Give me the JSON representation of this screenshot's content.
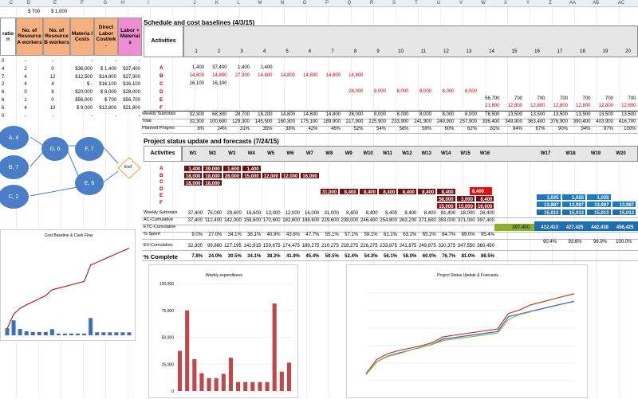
{
  "column_headers": [
    "C",
    "D",
    "E",
    "F",
    "G",
    "H",
    "I",
    "J",
    "K",
    "L",
    "M",
    "N",
    "O",
    "P",
    "Q",
    "R",
    "S",
    "T",
    "U",
    "V",
    "W",
    "X",
    "Y",
    "Z",
    "AA",
    "AB",
    "AC"
  ],
  "top_row": {
    "d": "$ 700",
    "e": "$ 1,000"
  },
  "left_table": {
    "headers": [
      "ratio n",
      "No. of Resource A workers",
      "No. of Resource B workers",
      "Materia l Costs",
      "Direct Labor Cost/wk .",
      "Labor + Material s"
    ],
    "rows": [
      [
        "0",
        "-",
        "-",
        "-",
        "-",
        "-"
      ],
      [
        "4",
        "2",
        "0",
        "$36,000",
        "$ 1,400",
        "$37,400"
      ],
      [
        "7",
        "4",
        "12",
        "$12,500",
        "$14,800",
        "$27,300"
      ],
      [
        "2",
        "4",
        "4",
        "$ -",
        "$16,100",
        "$16,100"
      ],
      [
        "6",
        "0",
        "8",
        "$20,000",
        "$ 8,000",
        "$28,000"
      ],
      [
        "6",
        "1",
        "0",
        "$56,000",
        "$ 700",
        "$56,700"
      ],
      [
        "6",
        "4",
        "10",
        "$ 9,000",
        "$12,800",
        "$21,800"
      ],
      [
        "0",
        "-",
        "-",
        "-",
        "-",
        "-"
      ]
    ]
  },
  "baseline": {
    "title": "Schedule and cost baselines (4/3/15)",
    "activities_label": "Activities",
    "weeks": [
      "1",
      "2",
      "3",
      "4",
      "5",
      "6",
      "7",
      "8",
      "9",
      "10",
      "11",
      "12",
      "13",
      "14",
      "15",
      "16",
      "17",
      "18",
      "19",
      "20"
    ],
    "activities": [
      "A",
      "B",
      "C",
      "D",
      "E",
      "F"
    ],
    "rows": {
      "A": [
        "1,400",
        "37,400",
        "1,400",
        "1,400"
      ],
      "B": [
        "14,800",
        "14,800",
        "27,300",
        "14,800",
        "14,800",
        "14,800",
        "14,800",
        "14,800"
      ],
      "C": [
        "16,100",
        "16,100"
      ],
      "D": [
        "28,000",
        "8,000",
        "8,000",
        "8,000",
        "8,000",
        "8,000"
      ],
      "E": [
        "56,700",
        "700",
        "700",
        "700",
        "700",
        "700",
        "700"
      ],
      "F": [
        "21,800",
        "12,800",
        "12,800",
        "12,800",
        "12,800",
        "12,800",
        "12,800"
      ]
    },
    "weekly_label": "Weekly Subtotals",
    "weekly": [
      "32,300",
      "68,300",
      "28,700",
      "18,200",
      "14,800",
      "14,800",
      "14,800",
      "28,000",
      "8,000",
      "8,000",
      "8,000",
      "8,000",
      "8,000",
      "78,500",
      "13,500",
      "13,500",
      "13,500",
      "13,500",
      "13,500",
      "13,500"
    ],
    "total_label": "Total",
    "total": [
      "32,300",
      "100,600",
      "129,300",
      "145,500",
      "160,300",
      "175,100",
      "189,900",
      "217,900",
      "225,900",
      "233,900",
      "241,900",
      "249,900",
      "257,900",
      "336,400",
      "349,900",
      "363,400",
      "376,900",
      "390,400",
      "403,900",
      "416,700"
    ],
    "planned_label": "Planned Progres",
    "planned": [
      "8%",
      "24%",
      "31%",
      "35%",
      "38%",
      "42%",
      "46%",
      "52%",
      "54%",
      "56%",
      "58%",
      "60%",
      "62%",
      "81%",
      "84%",
      "87%",
      "90%",
      "94%",
      "97%",
      "100%"
    ]
  },
  "status": {
    "title": "Project status update and forecasts (7/24/15)",
    "activities_label": "Activities",
    "weeks": [
      "W1",
      "W2",
      "W3",
      "W4",
      "W5",
      "W6",
      "W7",
      "W8",
      "W9",
      "W10",
      "W11",
      "W12",
      "W13",
      "W14",
      "W15",
      "W16",
      "W17",
      "W18",
      "W19",
      "W20"
    ],
    "activities": [
      "A",
      "B",
      "C",
      "D",
      "E",
      "F"
    ],
    "A": [
      "1,400",
      "39,000",
      "1,600",
      "1,400"
    ],
    "B": [
      "18,000",
      "18,000",
      "28,000",
      "15,000",
      "12,000",
      "12,000",
      "16,000"
    ],
    "C": [
      "18,000",
      "18,000"
    ],
    "D": [
      "31,000",
      "8,400",
      "8,400",
      "8,400",
      "8,400",
      "8,400",
      "8,400"
    ],
    "E": [
      "58,000",
      "3,000",
      "8,400"
    ],
    "F": [
      "15,000",
      "15,000",
      "16,000"
    ],
    "forecast_E": [
      "1,025",
      "1,025",
      "1,025"
    ],
    "forecast_E2": [
      "13,987",
      "13,987",
      "13,987",
      "13,987"
    ],
    "forecast_F": [
      "15,013",
      "15,013",
      "15,013",
      "15,013"
    ],
    "weekly_label": "Weekly Subtotals",
    "weekly": [
      "37,400",
      "75,000",
      "29,600",
      "16,600",
      "12,000",
      "12,000",
      "16,000",
      "31,000",
      "8,400",
      "8,400",
      "8,400",
      "8,400",
      "8,400",
      "81,400",
      "18,000",
      "26,400"
    ],
    "ac_label": "AC-Cumulative",
    "ac": [
      "37,400",
      "112,400",
      "142,000",
      "158,600",
      "170,600",
      "182,600",
      "198,600",
      "229,600",
      "238,000",
      "246,400",
      "254,800",
      "263,200",
      "271,600",
      "353,000",
      "371,000",
      "397,400"
    ],
    "etc_label": "ETC-Cumulative",
    "etc": [
      "397,400",
      "412,413",
      "427,425",
      "442,438",
      "456,425"
    ],
    "spent_label": "% Spent",
    "spent": [
      "9.0%",
      "27.0%",
      "34.1%",
      "38.1%",
      "40.9%",
      "43.8%",
      "47.7%",
      "55.1%",
      "57.1%",
      "59.1%",
      "61.1%",
      "63.2%",
      "65.2%",
      "84.7%",
      "89.0%",
      "95.4%"
    ],
    "forecast_spent": [
      "90.4%",
      "93.6%",
      "96.9%",
      "100.0%"
    ],
    "ev_label": "EV-Cumulative",
    "ev": [
      "32,300",
      "99,860",
      "127,195",
      "141,915",
      "159,675",
      "174,475",
      "189,275",
      "210,275",
      "218,275",
      "226,275",
      "233,875",
      "241,875",
      "249,875",
      "320,375",
      "347,550",
      "360,450"
    ],
    "complete_label": "% Complete",
    "complete": [
      "7.8%",
      "24.0%",
      "30.5%",
      "34.1%",
      "38.3%",
      "41.9%",
      "45.4%",
      "50.5%",
      "52.4%",
      "54.3%",
      "56.1%",
      "58.0%",
      "60.0%",
      "76.7%",
      "81.0%",
      "86.5%"
    ]
  },
  "network": {
    "nodes": [
      "A, 4",
      "B, 7",
      "C, 2",
      "D, 6",
      "F, 7",
      "E, 6",
      "End"
    ]
  },
  "chart_data": [
    {
      "type": "bar",
      "title": "Cost Baseline & Cash Flow",
      "values": [
        32300,
        68300,
        28700,
        18200,
        14800,
        14800,
        14800,
        28000,
        8000,
        8000,
        8000,
        8000,
        8000,
        78500,
        13500,
        13500,
        13500,
        13500,
        13500,
        13500
      ],
      "line": [
        32300,
        100600,
        129300,
        145500,
        160300,
        175100,
        189900,
        217900,
        225900,
        233900,
        241900,
        249900,
        257900,
        336400,
        349900,
        363400,
        376900,
        390400,
        403900,
        416700
      ]
    },
    {
      "type": "bar",
      "title": "Weekly expenditures",
      "ylim": [
        0,
        100000
      ],
      "yticks": [
        "100,000",
        "75,000",
        "50,000",
        "25,000",
        "0"
      ],
      "values": [
        37400,
        75000,
        29600,
        16600,
        12000,
        12000,
        16000,
        31000,
        8400,
        8400,
        8400,
        8400,
        8400,
        81400,
        18000,
        26400
      ]
    },
    {
      "type": "line",
      "title": "Project Status Update & Forecasts",
      "series": [
        {
          "color": "#2f5fbf",
          "values": [
            32300,
            100600,
            129300,
            145500,
            160300,
            175100,
            189900,
            217900,
            225900,
            233900,
            241900,
            249900,
            257900,
            336400,
            349900,
            363400,
            376900,
            390400,
            403900,
            416700
          ]
        },
        {
          "color": "#c0392b",
          "values": [
            37400,
            112400,
            142000,
            158600,
            170600,
            182600,
            198600,
            229600,
            238000,
            246400,
            254800,
            263200,
            271600,
            353000,
            371000,
            397400,
            412413,
            427425,
            442438,
            456425
          ]
        },
        {
          "color": "#8cb43c",
          "values": [
            32300,
            99860,
            127195,
            141915,
            159675,
            174475,
            189275,
            210275,
            218275,
            226275,
            233875,
            241875,
            249875,
            320375,
            347550,
            360450
          ]
        }
      ]
    }
  ]
}
